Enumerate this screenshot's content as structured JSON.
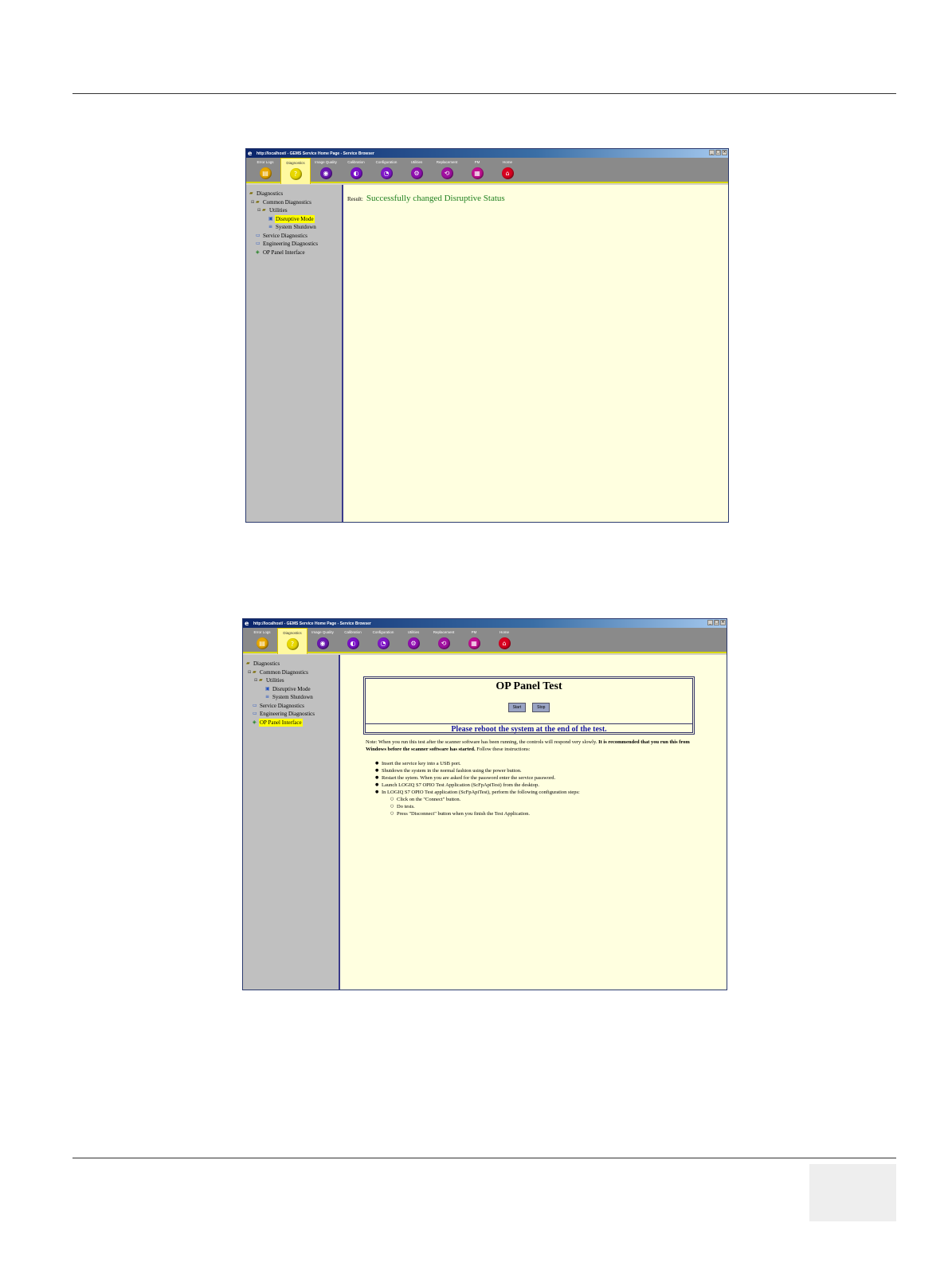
{
  "windows": [
    {
      "title": "http://localhost/ - GEMS Service Home Page - Service Browser",
      "toolbar": [
        {
          "label": "Error Logs",
          "color": "#e8a800",
          "glyph": "▤"
        },
        {
          "label": "Diagnostics",
          "color": "#e8d800",
          "glyph": "?"
        },
        {
          "label": "Image Quality",
          "color": "#6a18b0",
          "glyph": "◉"
        },
        {
          "label": "Calibration",
          "color": "#7a10c8",
          "glyph": "◐"
        },
        {
          "label": "Configuration",
          "color": "#8018c8",
          "glyph": "◔"
        },
        {
          "label": "Utilities",
          "color": "#9010b0",
          "glyph": "⚙"
        },
        {
          "label": "Replacement",
          "color": "#a010a0",
          "glyph": "⟲"
        },
        {
          "label": "PM",
          "color": "#c01090",
          "glyph": "▦"
        },
        {
          "label": "Home",
          "color": "#d80020",
          "glyph": "⌂"
        }
      ],
      "tree": {
        "diagnostics": "Diagnostics",
        "common": "Common Diagnostics",
        "utilities": "Utilities",
        "disruptive": "Disruptive Mode",
        "shutdown": "System Shutdown",
        "service": "Service Diagnostics",
        "engineering": "Engineering Diagnostics",
        "op_panel": "OP Panel Interface"
      },
      "result_label": "Result:",
      "result_value": "Successfully changed Disruptive Status"
    },
    {
      "title": "http://localhost/ - GEMS Service Home Page - Service Browser",
      "tree": {
        "diagnostics": "Diagnostics",
        "common": "Common Diagnostics",
        "utilities": "Utilities",
        "disruptive": "Disruptive Mode",
        "shutdown": "System Shutdown",
        "service": "Service Diagnostics",
        "engineering": "Engineering Diagnostics",
        "op_panel": "OP Panel Interface"
      },
      "op_title": "OP Panel Test",
      "start_label": "Start",
      "stop_label": "Stop",
      "reboot_text": "Please reboot the system at the end of the test.",
      "note_plain": "Note: When you run this test after the scanner software has been running, the controls will respond very slowly. ",
      "note_bold": "It is recommended that you run this from Windows before the scanner software has started.",
      "note_tail": " Follow these instructions:",
      "steps": [
        "Insert the service key into a USB port.",
        "Shutdown the system in the normal fashion using the power button.",
        "Restart the sytem. When you are asked for the password enter the service password.",
        "Launch LOGIQ S7 OPIO Test Application (ScFpApiTest) from the desktop.",
        "In LOGIQ S7 OPIO Test application (ScFpApiTest), perform the following configuration steps:"
      ],
      "substeps": [
        "Click on the \"Connect\" button.",
        "Do tests.",
        "Press \"Disconnect\" button when you finish the Test Application."
      ]
    }
  ]
}
